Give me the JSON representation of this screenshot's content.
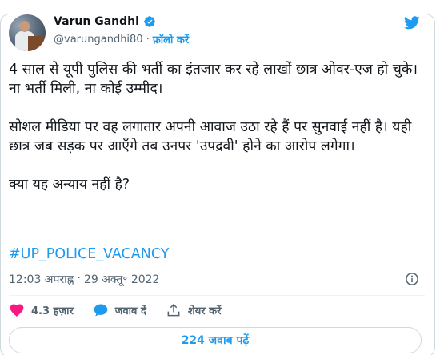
{
  "author": {
    "name": "Varun Gandhi",
    "handle": "@varungandhi80",
    "separator": "·",
    "follow_label": "फ़ॉलो करें",
    "avatar": "speaker-at-podium-avatar"
  },
  "tweet": {
    "paragraphs": [
      "4 साल से यूपी पुलिस की भर्ती का इंतजार कर रहे लाखों छात्र ओवर-एज हो चुके। ना भर्ती मिली, ना कोई उम्मीद।",
      "सोशल मीडिया पर वह लगातार अपनी आवाज उठा रहे हैं पर सुनवाई नहीं है। यही छात्र जब सड़क पर आएँगे तब उनपर 'उपद्रवी' होने का आरोप लगेगा।",
      "क्या यह अन्याय नहीं है?"
    ],
    "hashtag": "#UP_POLICE_VACANCY",
    "time": "12:03 अपराह्न",
    "date_separator": "·",
    "date": "29 अक्तू॰ 2022"
  },
  "actions": {
    "like_count": "4.3 हज़ार",
    "reply_label": "जवाब दें",
    "share_label": "शेयर करें"
  },
  "replies_button": "224 जवाब पढ़ें",
  "colors": {
    "accent": "#1d9bf0",
    "like": "#f91880",
    "text": "#0f1419",
    "muted": "#536471",
    "border": "#cfd9de"
  }
}
